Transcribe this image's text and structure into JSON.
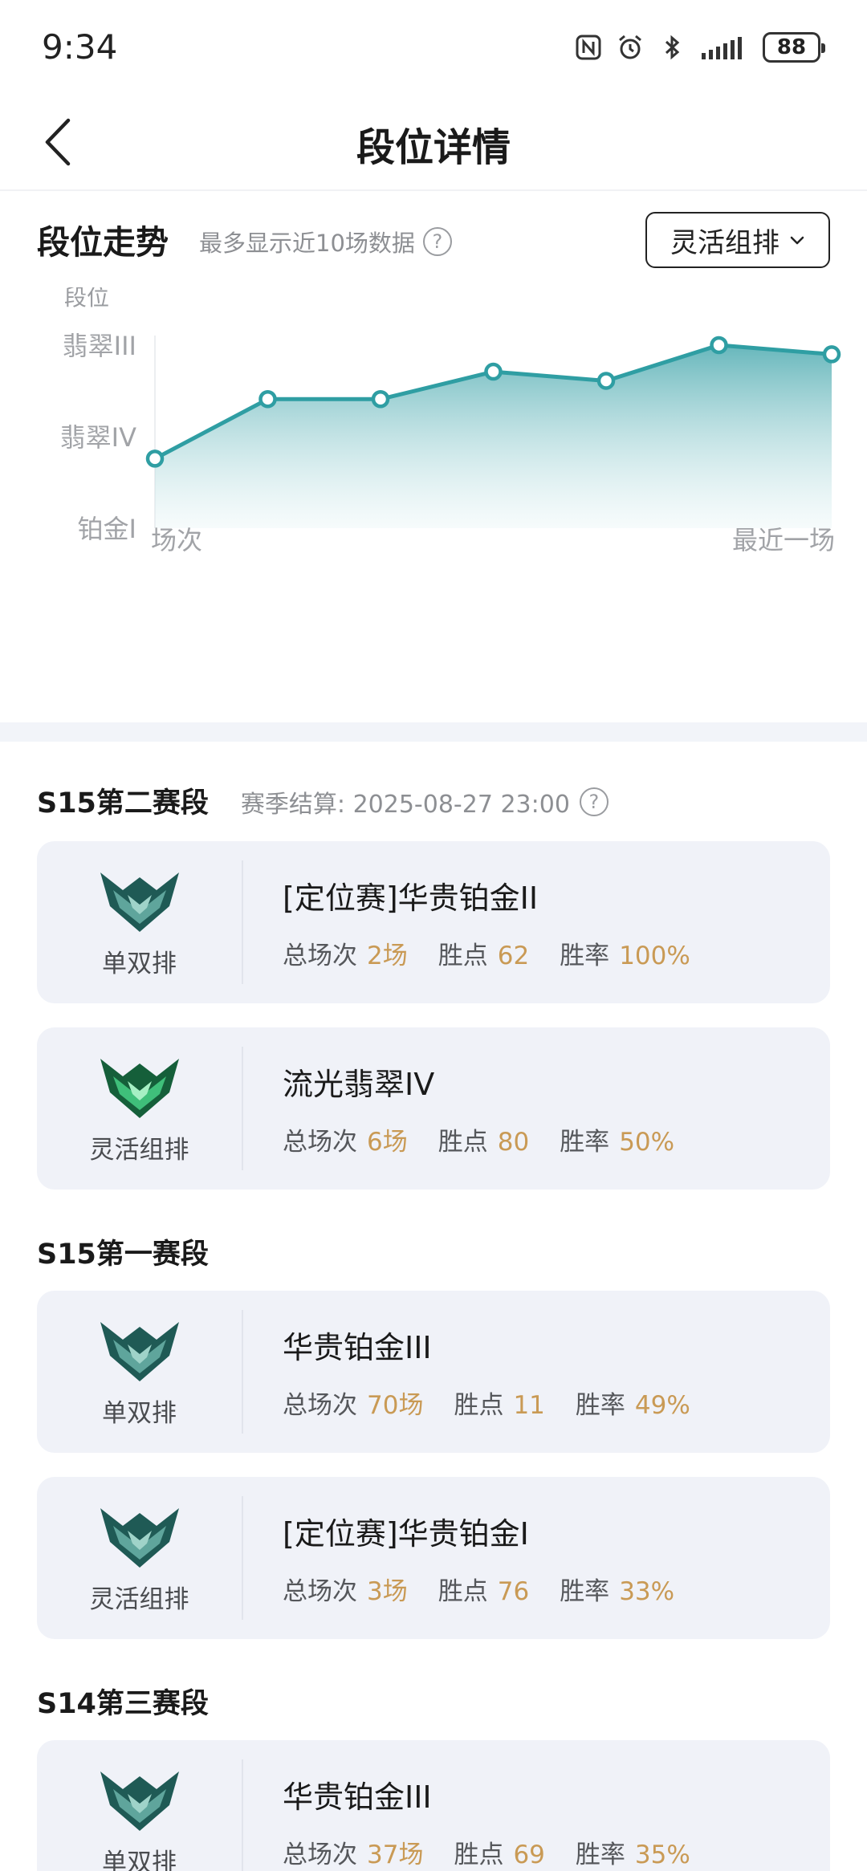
{
  "status_bar": {
    "time": "9:34",
    "battery": "88"
  },
  "header": {
    "title": "段位详情"
  },
  "trend": {
    "title": "段位走势",
    "subtitle": "最多显示近10场数据",
    "mode": "灵活组排"
  },
  "chart_data": {
    "type": "area",
    "y_axis_title": "段位",
    "y_ticks": [
      "翡翠III",
      "翡翠IV",
      "铂金I"
    ],
    "ylim": [
      0,
      2
    ],
    "x_label_start": "场次",
    "x_label_end": "最近一场",
    "x": [
      1,
      2,
      3,
      4,
      5,
      6,
      7
    ],
    "values": [
      0.76,
      1.41,
      1.41,
      1.71,
      1.61,
      2.0,
      1.9
    ],
    "grid": false,
    "legend": "none",
    "colors": {
      "line": "#2f9ea3",
      "fill_top": "#5fb3b8",
      "fill_bottom": "#e6f4f5"
    }
  },
  "seasons": [
    {
      "title": "S15第二赛段",
      "settle": "赛季结算: 2025-08-27 23:00",
      "cards": [
        {
          "queue": "单双排",
          "rank": "[定位赛]华贵铂金II",
          "stats": [
            {
              "label": "总场次",
              "value": "2场"
            },
            {
              "label": "胜点",
              "value": "62"
            },
            {
              "label": "胜率",
              "value": "100%"
            }
          ],
          "emblem": "platinum-emblem-icon"
        },
        {
          "queue": "灵活组排",
          "rank": "流光翡翠IV",
          "stats": [
            {
              "label": "总场次",
              "value": "6场"
            },
            {
              "label": "胜点",
              "value": "80"
            },
            {
              "label": "胜率",
              "value": "50%"
            }
          ],
          "emblem": "emerald-emblem-icon"
        }
      ]
    },
    {
      "title": "S15第一赛段",
      "cards": [
        {
          "queue": "单双排",
          "rank": "华贵铂金III",
          "stats": [
            {
              "label": "总场次",
              "value": "70场"
            },
            {
              "label": "胜点",
              "value": "11"
            },
            {
              "label": "胜率",
              "value": "49%"
            }
          ],
          "emblem": "platinum-emblem-icon"
        },
        {
          "queue": "灵活组排",
          "rank": "[定位赛]华贵铂金I",
          "stats": [
            {
              "label": "总场次",
              "value": "3场"
            },
            {
              "label": "胜点",
              "value": "76"
            },
            {
              "label": "胜率",
              "value": "33%"
            }
          ],
          "emblem": "platinum-emblem-icon"
        }
      ]
    },
    {
      "title": "S14第三赛段",
      "cards": [
        {
          "queue": "单双排",
          "rank": "华贵铂金III",
          "stats": [
            {
              "label": "总场次",
              "value": "37场"
            },
            {
              "label": "胜点",
              "value": "69"
            },
            {
              "label": "胜率",
              "value": "35%"
            }
          ],
          "emblem": "platinum-emblem-icon"
        }
      ]
    }
  ]
}
